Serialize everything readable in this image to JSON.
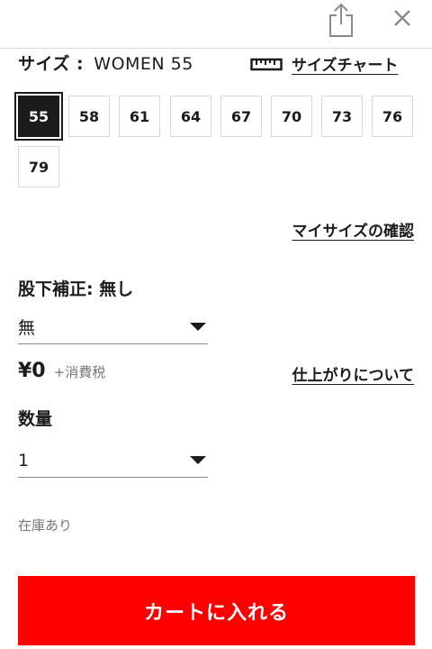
{
  "header": {
    "share_icon": "share-icon",
    "close_icon": "close-icon"
  },
  "size": {
    "heading_label": "サイズ :",
    "selected_value": "WOMEN  55",
    "chart_link": "サイズチャート",
    "chart_icon": "ruler-icon",
    "options": [
      "55",
      "58",
      "61",
      "64",
      "67",
      "70",
      "73",
      "76",
      "79"
    ],
    "selected": "55"
  },
  "my_size_link": "マイサイズの確認",
  "inseam": {
    "label": "股下補正: 無し",
    "value": "無"
  },
  "price": {
    "amount": "¥0",
    "tax_note": "+消費税"
  },
  "finish_link": "仕上がりについて",
  "quantity": {
    "label": "数量",
    "value": "1"
  },
  "stock_status": "在庫あり",
  "cart_button": "カートに入れる",
  "colors": {
    "cart_button": "#ff0000",
    "selected_size": "#1b1b1b"
  }
}
